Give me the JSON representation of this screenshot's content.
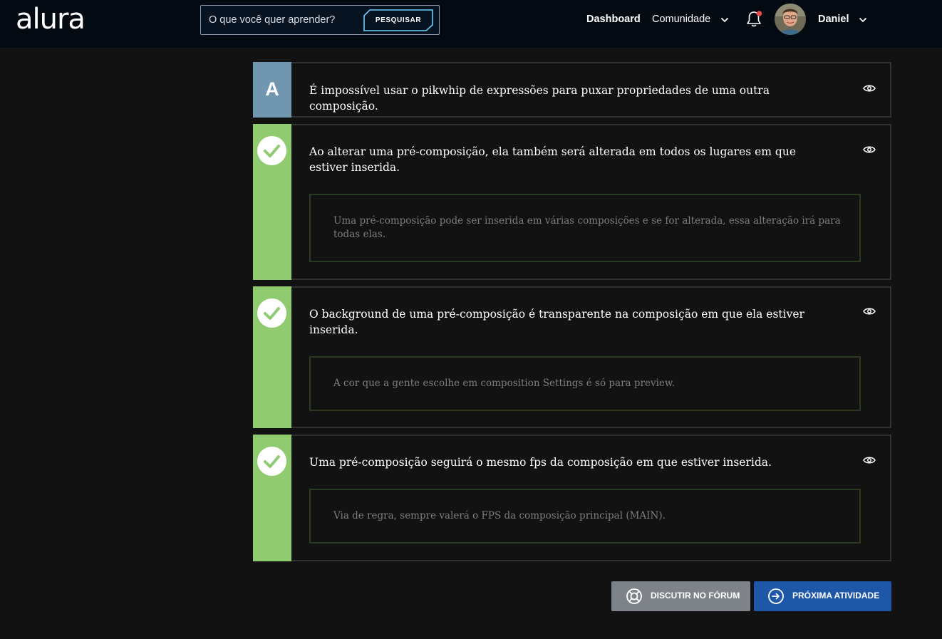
{
  "header": {
    "logo": "alura",
    "search_placeholder": "O que você quer aprender?",
    "search_button": "PESQUISAR",
    "nav_dashboard": "Dashboard",
    "nav_comunidade": "Comunidade",
    "user_name": "Daniel",
    "icons": [
      "chevron-down-icon",
      "bell-icon",
      "avatar"
    ]
  },
  "options": [
    {
      "marker": "A",
      "status": "unanswered",
      "text": "É impossível usar o pikwhip de expressões para puxar propriedades de uma outra composição.",
      "explanation": ""
    },
    {
      "marker": "",
      "status": "correct",
      "text": "Ao alterar uma pré-composição, ela também será alterada em todos os lugares em que estiver inserida.",
      "explanation": "Uma pré-composição pode ser inserida em várias composições e se for alterada, essa alteração irá para todas elas."
    },
    {
      "marker": "",
      "status": "correct",
      "text": "O background de uma pré-composição é transparente na composição em que ela estiver inserida.",
      "explanation": "A cor que a gente escolhe em composition Settings é só para preview."
    },
    {
      "marker": "",
      "status": "correct",
      "text": "Uma pré-composição seguirá o mesmo fps da composição em que estiver inserida.",
      "explanation": "Via de regra, sempre valerá o FPS da composição principal (MAIN)."
    }
  ],
  "footer": {
    "forum_button": "DISCUTIR NO FÓRUM",
    "next_button": "PRÓXIMA ATIVIDADE"
  },
  "colors": {
    "background": "#121212",
    "header": "#030a12",
    "letter_side": "#7196af",
    "correct_side": "#90cc6f",
    "next_button": "#1f57a8",
    "forum_button": "#7d8389",
    "notification_dot": "#e8484b"
  }
}
